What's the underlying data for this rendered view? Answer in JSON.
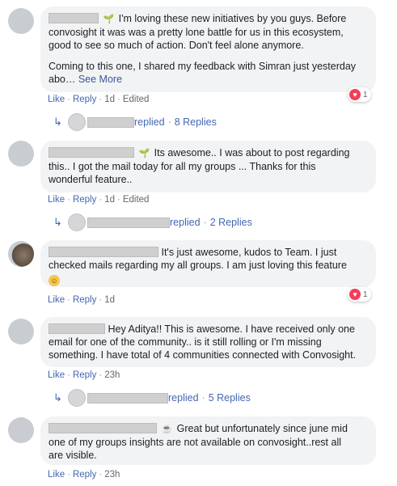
{
  "comments": [
    {
      "text1": "I'm loving these new initiatives by you guys. Before",
      "text2": "convosight it was was a pretty lone battle for us in this ecosystem,",
      "text3": "good to see so much of action. Don't feel alone anymore.",
      "text4": "Coming to this one, I shared my feedback with Simran just yesterday",
      "text5": "abo…",
      "see_more": "See More",
      "like": "Like",
      "reply": "Reply",
      "time": "1d",
      "edited": "Edited",
      "reaction_count": "1",
      "replies": "replied",
      "reply_count": "8 Replies"
    },
    {
      "text1": "Its awesome.. I was about to post regarding",
      "text2": "this.. I got the mail today for all my groups ... Thanks for this",
      "text3": "wonderful feature..",
      "like": "Like",
      "reply": "Reply",
      "time": "1d",
      "edited": "Edited",
      "replies": "replied",
      "reply_count": "2 Replies"
    },
    {
      "text1": "It's just awesome, kudos to Team. I just",
      "text2": "checked mails regarding my all groups. I am just loving this feature",
      "like": "Like",
      "reply": "Reply",
      "time": "1d",
      "reaction_count": "1"
    },
    {
      "text1": "Hey Aditya!! This is awesome. I have received only one",
      "text2": "email for one of the community.. is it still rolling or I'm missing",
      "text3": "something. I have total of 4 communities connected with Convosight.",
      "like": "Like",
      "reply": "Reply",
      "time": "23h",
      "replies": "replied",
      "reply_count": "5 Replies"
    },
    {
      "text1": "Great but unfortunately since june mid",
      "text2": "one of my groups insights are not available on convosight..rest all",
      "text3": "are visible.",
      "like": "Like",
      "reply": "Reply",
      "time": "23h"
    }
  ],
  "icons": {
    "leaf": "leaf-icon",
    "heart": "heart-icon",
    "reply_arrow": "reply-arrow-icon",
    "emoji_smile": "smile-emoji-icon",
    "emoji_coffee": "coffee-emoji-icon"
  },
  "colors": {
    "link": "#4267b2",
    "bubble": "#f2f3f5",
    "heart": "#f33e58"
  }
}
